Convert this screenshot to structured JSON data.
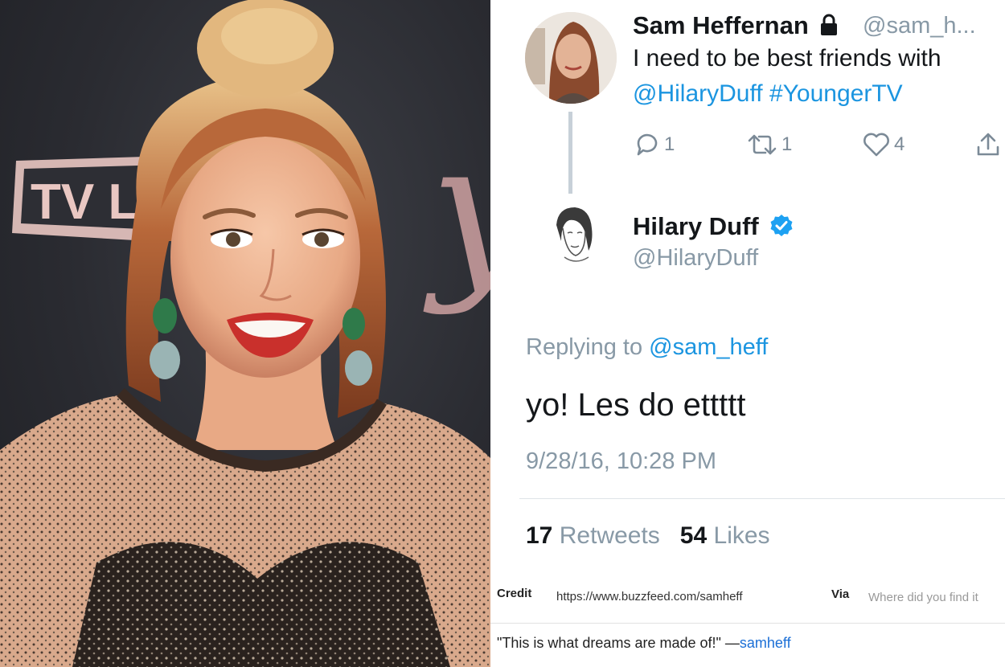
{
  "photo": {
    "backdrop_logo": "TV LA",
    "backdrop_script": "y"
  },
  "tweet": {
    "parent": {
      "display_name": "Sam Heffernan",
      "handle": "@sam_h...",
      "line1": "I need to be best friends with",
      "mention": "@HilaryDuff",
      "hashtag": "#YoungerTV",
      "reply_count": "1",
      "retweet_count": "1",
      "like_count": "4"
    },
    "reply": {
      "display_name": "Hilary Duff",
      "handle": "@HilaryDuff",
      "replying_prefix": "Replying to",
      "replying_handle": "@sam_heff",
      "body": "yo! Les do ettttt",
      "timestamp": "9/28/16, 10:28 PM",
      "retweets_number": "17",
      "retweets_label": "Retweets",
      "likes_number": "54",
      "likes_label": "Likes"
    }
  },
  "credit": {
    "credit_label": "Credit",
    "credit_url": "https://www.buzzfeed.com/samheff",
    "via_label": "Via",
    "via_placeholder": "Where did you find it",
    "quote_text": "\"This is what dreams are made of!\" —",
    "quote_author": "samheff"
  },
  "colors": {
    "link": "#1b95e0",
    "verified": "#1da1f2",
    "muted": "#8899a6",
    "text": "#14171a",
    "lipstick": "#c9302c"
  },
  "icons": [
    "lock-icon",
    "verified-badge-icon",
    "reply-icon",
    "retweet-icon",
    "like-icon",
    "share-icon"
  ]
}
